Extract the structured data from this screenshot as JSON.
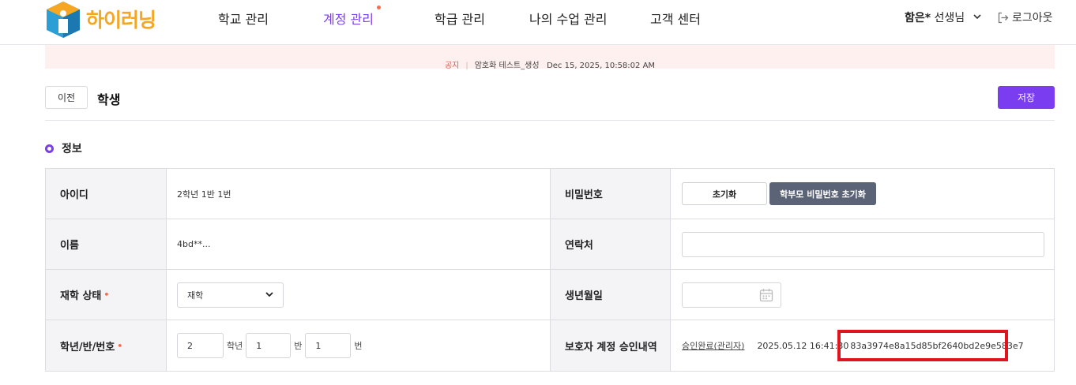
{
  "header": {
    "logo_text": "하이러닝",
    "nav": [
      {
        "label": "학교 관리",
        "active": false
      },
      {
        "label": "계정 관리",
        "active": true
      },
      {
        "label": "학급 관리",
        "active": false
      },
      {
        "label": "나의 수업 관리",
        "active": false
      },
      {
        "label": "고객 센터",
        "active": false
      }
    ],
    "user_name": "함은*",
    "user_role": "선생님",
    "logout_label": "로그아웃"
  },
  "notice": {
    "label": "공지",
    "message": "암호화 테스트_생성",
    "datetime": "Dec 15, 2025, 10:58:02 AM"
  },
  "title_bar": {
    "prev_label": "이전",
    "title": "학생",
    "save_label": "저장"
  },
  "section": {
    "title": "정보"
  },
  "form": {
    "id_label": "아이디",
    "id_value": "2학년 1반 1번",
    "password_label": "비밀번호",
    "reset_label": "초기화",
    "parent_reset_label": "학부모 비밀번호 초기화",
    "name_label": "이름",
    "name_value": "4bd**...",
    "contact_label": "연락처",
    "contact_value": "",
    "status_label": "재학 상태",
    "status_value": "재학",
    "birth_label": "생년월일",
    "birth_value": "",
    "grade_label": "학년/반/번호",
    "grade_value": "2",
    "grade_unit": "학년",
    "class_value": "1",
    "class_unit": "반",
    "number_value": "1",
    "number_unit": "번",
    "guardian_label": "보호자 계정 승인내역",
    "guardian_link": "승인완료(관리자)",
    "guardian_datetime": "2025.05.12 16:41:30",
    "guardian_hash": "83a3974e8a15d85bf2640bd2e9e583e7"
  },
  "colors": {
    "accent": "#7a3df0",
    "required": "#ff6a4d",
    "highlight": "#e0141e",
    "notice_bg": "#fdf0ef"
  }
}
